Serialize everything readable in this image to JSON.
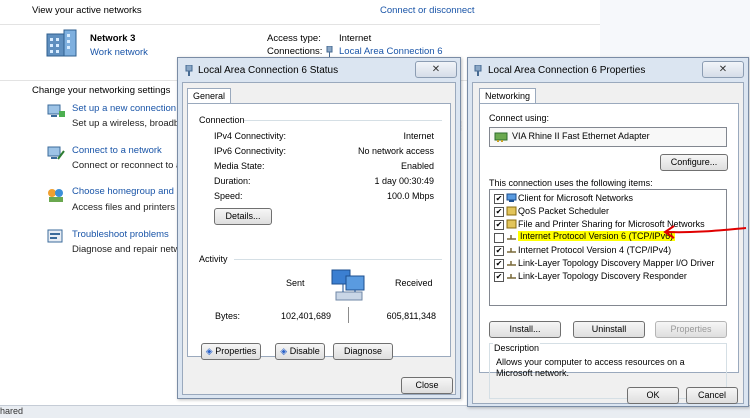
{
  "nsc": {
    "view_active_networks": "View your active networks",
    "connect_or_disconnect": "Connect or disconnect",
    "network_name": "Network  3",
    "network_type": "Work network",
    "access_type_label": "Access type:",
    "access_type_value": "Internet",
    "connections_label": "Connections:",
    "connections_value": "Local Area Connection 6",
    "change_settings": "Change your networking settings",
    "tasks": [
      {
        "title": "Set up a new connection or",
        "desc": "Set up a wireless, broadba"
      },
      {
        "title": "Connect to a network",
        "desc": "Connect or reconnect to a"
      },
      {
        "title": "Choose homegroup and s",
        "desc": "Access files and printers lo"
      },
      {
        "title": "Troubleshoot problems",
        "desc": "Diagnose and repair networ"
      }
    ],
    "bottom_left": "hared"
  },
  "status": {
    "title": "Local Area Connection 6 Status",
    "close_glyph": "✕",
    "tab": "General",
    "connection_label": "Connection",
    "rows": [
      {
        "label": "IPv4 Connectivity:",
        "value": "Internet"
      },
      {
        "label": "IPv6 Connectivity:",
        "value": "No network access"
      },
      {
        "label": "Media State:",
        "value": "Enabled"
      },
      {
        "label": "Duration:",
        "value": "1 day 00:30:49"
      },
      {
        "label": "Speed:",
        "value": "100.0 Mbps"
      }
    ],
    "details_btn": "Details...",
    "activity_label": "Activity",
    "sent_label": "Sent",
    "received_label": "Received",
    "bytes_label": "Bytes:",
    "bytes_sent": "102,401,689",
    "bytes_received": "605,811,348",
    "properties_btn": "Properties",
    "disable_btn": "Disable",
    "diagnose_btn": "Diagnose",
    "close_btn": "Close"
  },
  "props": {
    "title": "Local Area Connection 6 Properties",
    "close_glyph": "✕",
    "tab": "Networking",
    "connect_using_label": "Connect using:",
    "adapter": "VIA Rhine II Fast Ethernet Adapter",
    "configure_btn": "Configure...",
    "items_label": "This connection uses the following items:",
    "items": [
      {
        "label": "Client for Microsoft Networks",
        "checked": true,
        "highlight": false
      },
      {
        "label": "QoS Packet Scheduler",
        "checked": true,
        "highlight": false
      },
      {
        "label": "File and Printer Sharing for Microsoft Networks",
        "checked": true,
        "highlight": false
      },
      {
        "label": "Internet Protocol Version 6 (TCP/IPv6)",
        "checked": false,
        "highlight": true
      },
      {
        "label": "Internet Protocol Version 4 (TCP/IPv4)",
        "checked": true,
        "highlight": false
      },
      {
        "label": "Link-Layer Topology Discovery Mapper I/O Driver",
        "checked": true,
        "highlight": false
      },
      {
        "label": "Link-Layer Topology Discovery Responder",
        "checked": true,
        "highlight": false
      }
    ],
    "install_btn": "Install...",
    "uninstall_btn": "Uninstall",
    "properties_btn": "Properties",
    "description_label": "Description",
    "description_text": "Allows your computer to access resources on a Microsoft network.",
    "ok_btn": "OK",
    "cancel_btn": "Cancel",
    "check_glyph": "✔"
  },
  "colors": {
    "link": "#1a55a8",
    "highlight": "#ffff00",
    "annotation_arrow": "#e00000"
  }
}
